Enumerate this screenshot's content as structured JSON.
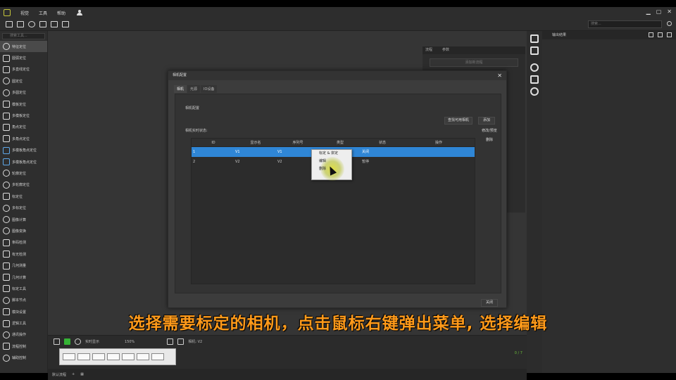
{
  "menubar": {
    "items": [
      "视觉",
      "工具",
      "帮助"
    ]
  },
  "left_panel": {
    "search_placeholder": "搜索工具...",
    "tools": [
      {
        "label": "特征定位"
      },
      {
        "label": "圆弧定位"
      },
      {
        "label": "多直线定位"
      },
      {
        "label": "圆定位"
      },
      {
        "label": "多圆定位"
      },
      {
        "label": "模板定位"
      },
      {
        "label": "多模板定位"
      },
      {
        "label": "角点定位"
      },
      {
        "label": "多角点定位"
      },
      {
        "label": "多模板角点定位"
      },
      {
        "label": "多模板角点定位"
      },
      {
        "label": "轮廓定位"
      },
      {
        "label": "多轮廓定位"
      },
      {
        "label": "标定位"
      },
      {
        "label": "多标定位"
      },
      {
        "label": "图像计算"
      },
      {
        "label": "图像变换"
      },
      {
        "label": "条码检测"
      },
      {
        "label": "有无检测"
      },
      {
        "label": "几何测量"
      },
      {
        "label": "几何计算"
      },
      {
        "label": "标定工具"
      },
      {
        "label": "脚本节点"
      },
      {
        "label": "模块设置"
      },
      {
        "label": "逻辑工具"
      },
      {
        "label": "通讯操作"
      },
      {
        "label": "流程控制"
      },
      {
        "label": "辅助控制"
      }
    ]
  },
  "right_panel": {
    "title": "输出结果"
  },
  "bg_panel": {
    "tab1": "流程",
    "tab2": "参数",
    "button": "添加新流程"
  },
  "dialog": {
    "title": "相机配置",
    "tabs": [
      "相机",
      "光源",
      "IO设备"
    ],
    "section": "相机配置",
    "list_label": "相机实时状态:",
    "find_button": "查找可用相机",
    "add_button": "添加",
    "side_buttons": [
      "修改/预览",
      "删除"
    ],
    "columns": [
      "ID",
      "显示名",
      "序列号",
      "类型",
      "状态",
      "操作"
    ],
    "rows": [
      {
        "id": "1",
        "name": "V1",
        "sn": "V1",
        "type": "",
        "status": "关闭",
        "op": ""
      },
      {
        "id": "2",
        "name": "V2",
        "sn": "V2",
        "type": "",
        "status": "暂停",
        "op": ""
      }
    ],
    "close_button": "关闭"
  },
  "context_menu": {
    "items": [
      "标定 & 拼定",
      "编辑",
      "删除"
    ]
  },
  "bottom": {
    "mode": "实时显示",
    "zoom": "150%",
    "camera": "相机: V2",
    "count": "0 / 7",
    "status_left": "默认流程"
  },
  "subtitle": "选择需要标定的相机，点击鼠标右键弹出菜单, 选择编辑"
}
